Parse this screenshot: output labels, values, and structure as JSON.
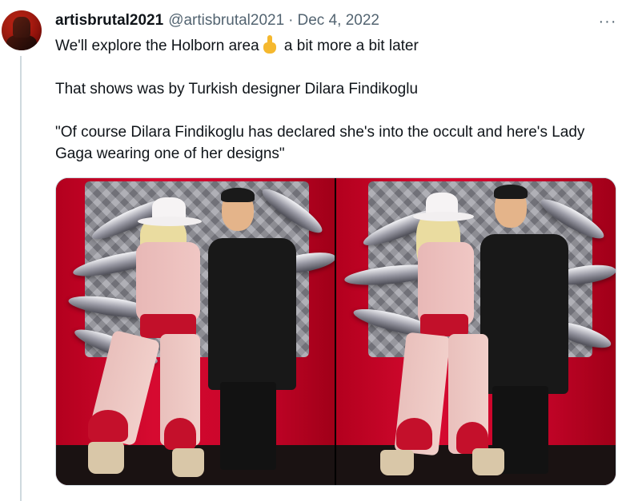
{
  "tweet": {
    "display_name": "artisbrutal2021",
    "handle": "@artisbrutal2021",
    "separator": "·",
    "date": "Dec 4, 2022",
    "more_icon": "more-horizontal-icon",
    "more_glyph": "···",
    "line1_before_emoji": "We'll explore the Holborn area",
    "emoji": "pointing-up-hand-emoji",
    "line1_after_emoji": " a bit more a bit later",
    "line2": "That shows was by Turkish designer Dilara Findikoglu",
    "line3": "\"Of course Dilara Findikoglu has declared she's into the occult and here's Lady Gaga wearing one of her designs\""
  },
  "media": {
    "photo_count": 2,
    "photos": [
      {
        "name": "photo-left"
      },
      {
        "name": "photo-right"
      }
    ]
  },
  "colors": {
    "text_primary": "#0f1419",
    "text_secondary": "#536471",
    "border": "#cfd9de",
    "backdrop_red": "#d60a30"
  }
}
